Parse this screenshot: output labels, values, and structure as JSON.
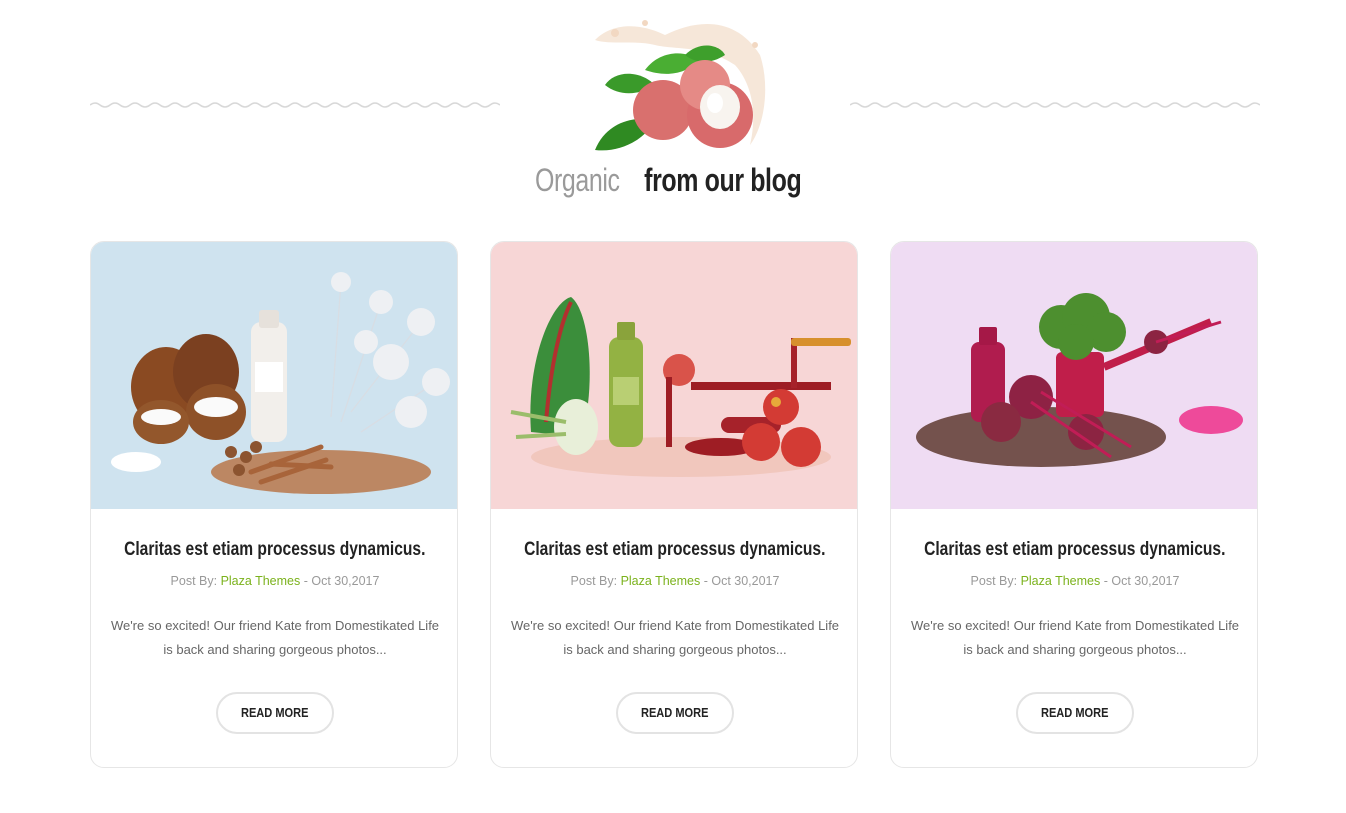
{
  "section": {
    "heading_light": "Organic",
    "heading_bold": "from our blog"
  },
  "posts": [
    {
      "title": "Claritas est etiam processus dynamicus.",
      "meta_prefix": "Post By:",
      "author": "Plaza Themes",
      "date_sep": "- Oct 30,2017",
      "excerpt": "We're so excited! Our friend Kate from Domestikated Life is back and sharing gorgeous photos...",
      "button": "READ MORE",
      "image": "coconut-milk-bottle-photo"
    },
    {
      "title": "Claritas est etiam processus dynamicus.",
      "meta_prefix": "Post By:",
      "author": "Plaza Themes",
      "date_sep": "- Oct 30,2017",
      "excerpt": "We're so excited! Our friend Kate from Domestikated Life is back and sharing gorgeous photos...",
      "button": "READ MORE",
      "image": "green-juice-apple-peeler-photo"
    },
    {
      "title": "Claritas est etiam processus dynamicus.",
      "meta_prefix": "Post By:",
      "author": "Plaza Themes",
      "date_sep": "- Oct 30,2017",
      "excerpt": "We're so excited! Our friend Kate from Domestikated Life is back and sharing gorgeous photos...",
      "button": "READ MORE",
      "image": "beet-juice-watering-can-photo"
    }
  ],
  "colors": {
    "accent": "#7bb21c",
    "heading": "#222222",
    "muted": "#999999",
    "card1_bg": "#cfe3ef",
    "card2_bg": "#f7d6d6",
    "card3_bg": "#efdcf3"
  }
}
